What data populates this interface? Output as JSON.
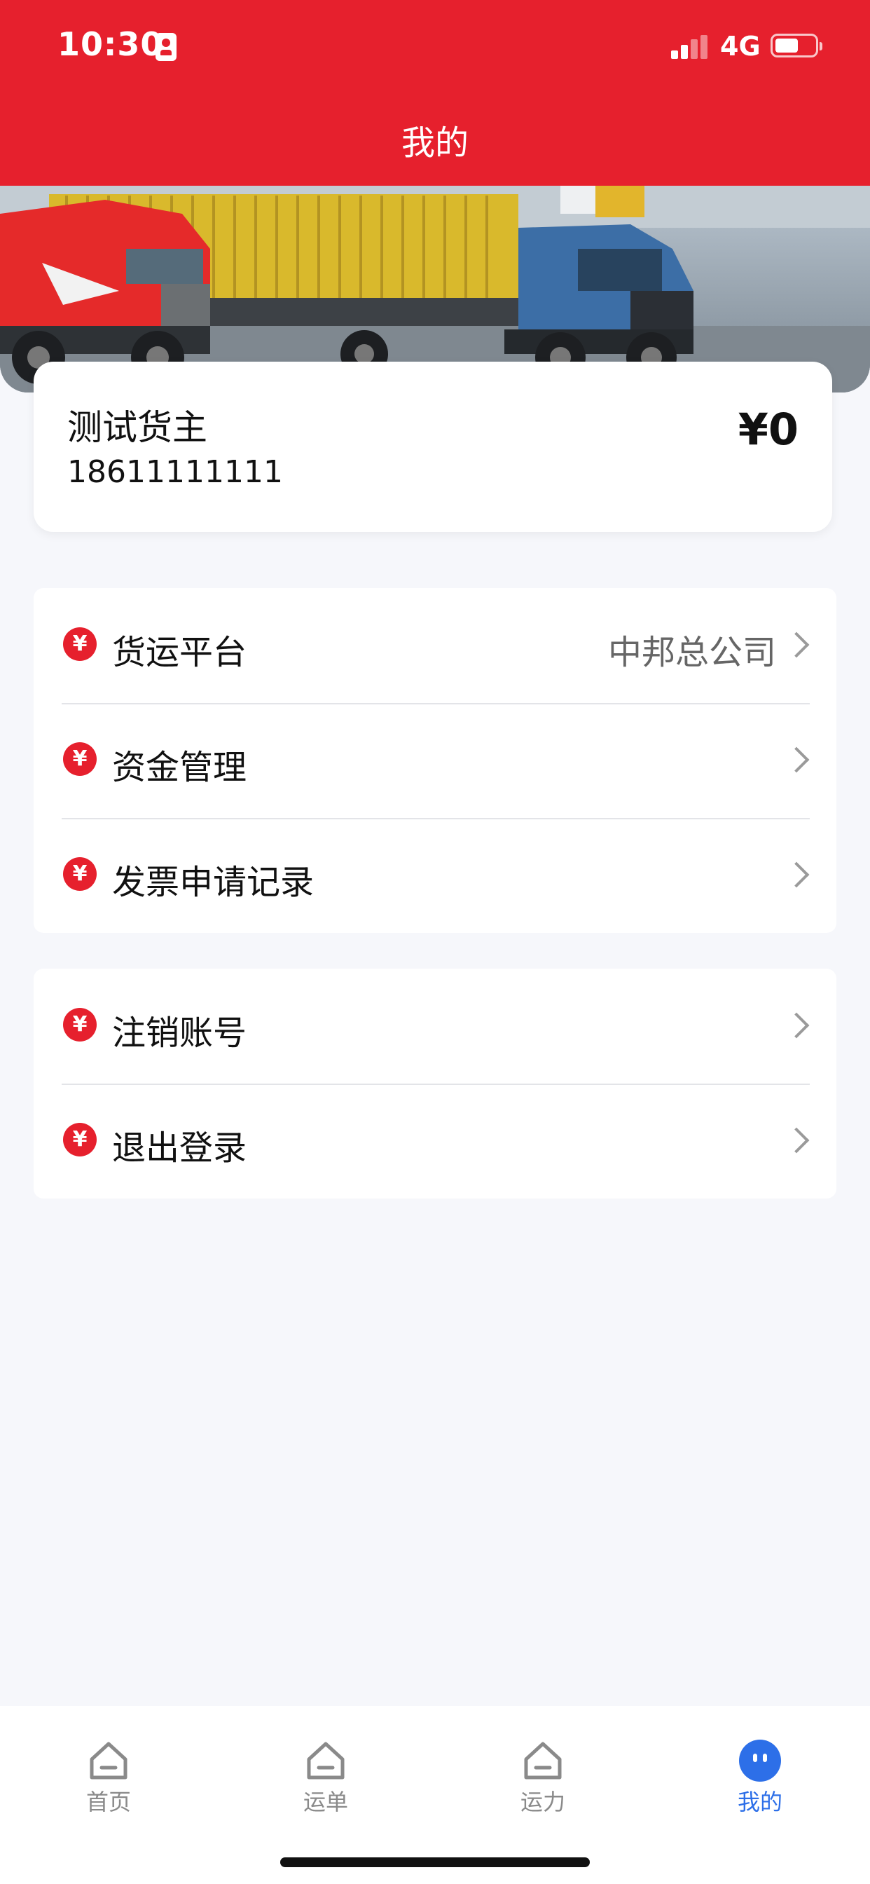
{
  "status_bar": {
    "time": "10:30",
    "network": "4G"
  },
  "header": {
    "title": "我的"
  },
  "profile": {
    "name": "测试货主",
    "phone": "18611111111",
    "balance": "¥0"
  },
  "menu_groups": [
    {
      "items": [
        {
          "icon": "yen-icon",
          "label": "货运平台",
          "value": "中邦总公司"
        },
        {
          "icon": "yen-icon",
          "label": "资金管理",
          "value": ""
        },
        {
          "icon": "yen-icon",
          "label": "发票申请记录",
          "value": ""
        }
      ]
    },
    {
      "items": [
        {
          "icon": "yen-icon",
          "label": "注销账号",
          "value": ""
        },
        {
          "icon": "yen-icon",
          "label": "退出登录",
          "value": ""
        }
      ]
    }
  ],
  "icons": {
    "yen_glyph": "¥"
  },
  "tabbar": {
    "items": [
      {
        "label": "首页",
        "icon": "home-icon",
        "active": false
      },
      {
        "label": "运单",
        "icon": "home-icon",
        "active": false
      },
      {
        "label": "运力",
        "icon": "home-icon",
        "active": false
      },
      {
        "label": "我的",
        "icon": "profile-face-icon",
        "active": true
      }
    ]
  },
  "colors": {
    "brand_red": "#e6202d",
    "active_tab_blue": "#2d6fe8"
  }
}
